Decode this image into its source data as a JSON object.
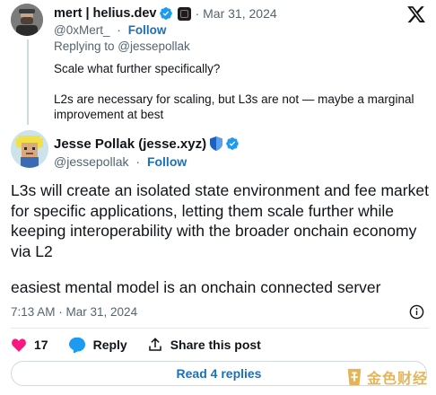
{
  "parent_tweet": {
    "author_name": "mert | helius.dev",
    "date": "Mar 31, 2024",
    "handle": "@0xMert_",
    "follow_label": "Follow",
    "replying_to": "Replying to @jessepollak",
    "body": [
      "Scale what further specifically?",
      "L2s are necessary for scaling, but L3s are not — maybe a marginal improvement at best"
    ]
  },
  "main_tweet": {
    "author_name": "Jesse Pollak (jesse.xyz)",
    "handle": "@jessepollak",
    "follow_label": "Follow",
    "body": [
      "L3s will create an isolated state environment and fee market for specific applications, letting them scale further while keeping interoperability with the broader onchain economy via L2",
      "easiest mental model is an onchain connected server"
    ],
    "timestamp": "7:13 AM · Mar 31, 2024",
    "like_count": "17",
    "reply_label": "Reply",
    "share_label": "Share this post",
    "read_replies_label": "Read 4 replies"
  },
  "watermark": {
    "text": "金色财经"
  },
  "icons": {
    "verified": "verified-badge-icon",
    "affiliate": "affiliate-badge-icon",
    "platform": "x-logo-icon",
    "shield": "shield-badge-icon",
    "info": "info-icon",
    "like": "heart-icon",
    "reply": "speech-bubble-icon",
    "share": "share-upload-icon"
  },
  "colors": {
    "link_blue": "#1d6fb8",
    "verified_blue": "#1d9bf0",
    "like_red": "#f91880",
    "muted_text": "#536471",
    "watermark_gold": "#e0a93b"
  }
}
